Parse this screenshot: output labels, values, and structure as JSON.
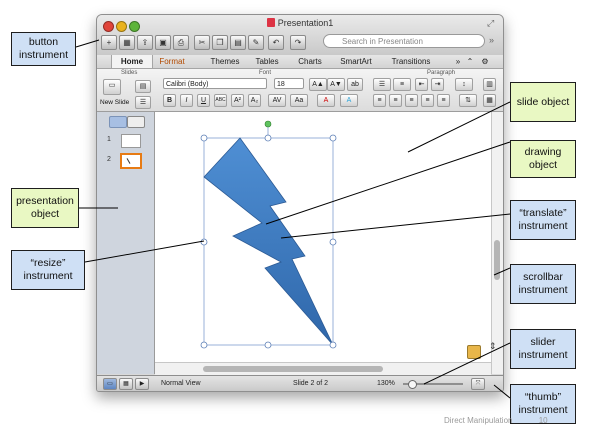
{
  "window": {
    "title": "Presentation1",
    "search_placeholder": "Search in Presentation",
    "tabs": [
      "Home",
      "Format",
      "Themes",
      "Tables",
      "Charts",
      "SmartArt",
      "Transitions"
    ],
    "group_labels": {
      "slides": "Slides",
      "font": "Font",
      "paragraph": "Paragraph"
    },
    "new_slide_label": "New Slide",
    "font_name": "Calibri (Body)",
    "font_size": "18",
    "status": {
      "view": "Normal View",
      "slide": "Slide 2 of 2",
      "zoom": "130%"
    },
    "zoom_fraction": 0.1,
    "slide_numbers": [
      "1",
      "2"
    ]
  },
  "callouts": {
    "button_instrument": "button instrument",
    "presentation_object": "presentation object",
    "resize_instrument": "“resize” instrument",
    "slide_object": "slide object",
    "drawing_object": "drawing object",
    "translate_instrument": "“translate” instrument",
    "scrollbar_instrument": "scrollbar instrument",
    "slider_instrument": "slider instrument",
    "thumb_instrument": "“thumb” instrument"
  },
  "footer": {
    "label": "Direct Manipulation",
    "page": "10"
  },
  "colors": {
    "object_callout": "#e9f8c3",
    "instrument_callout": "#cfe0f5",
    "shape_fill": "#3f7fc6",
    "active_tab_text": "#b24a00"
  },
  "icons": [
    "new-slide-icon",
    "gallery-icon",
    "open-icon",
    "save-icon",
    "print-icon",
    "cut-icon",
    "copy-icon",
    "paste-icon",
    "format-brush-icon",
    "undo-icon",
    "redo-icon",
    "search-icon",
    "rotate-handle-icon",
    "paste-options-icon",
    "expand-icon"
  ]
}
